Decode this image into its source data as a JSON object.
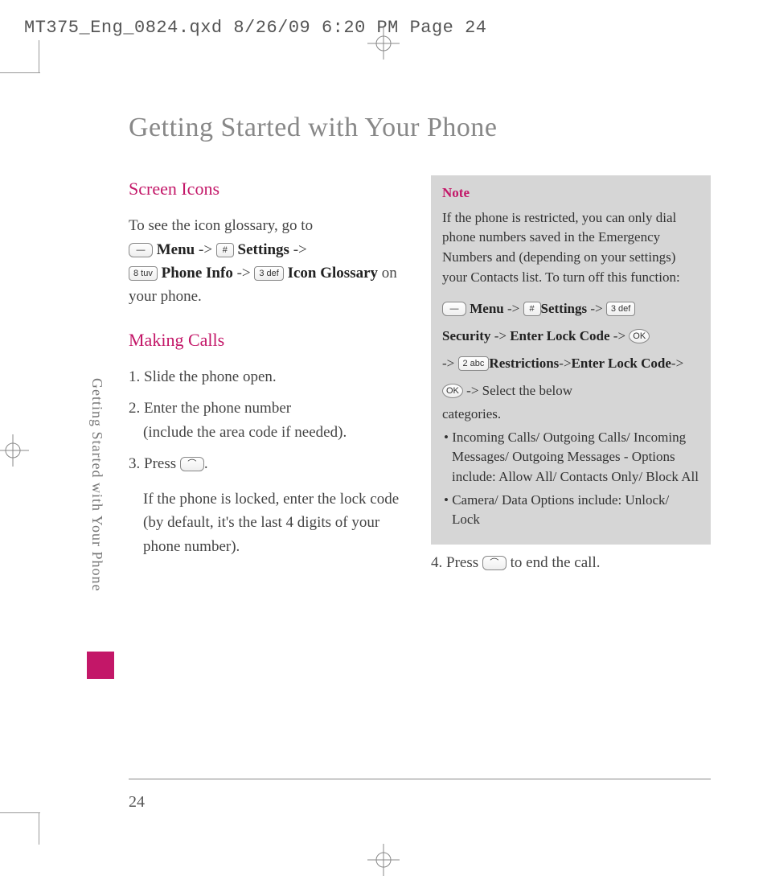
{
  "header_line": "MT375_Eng_0824.qxd  8/26/09  6:20 PM  Page 24",
  "side_tab": "Getting Started with Your Phone",
  "title": "Getting Started with Your Phone",
  "page_number": "24",
  "left": {
    "section1_title": "Screen Icons",
    "section1_intro": "To see the icon glossary, go to",
    "s1_menu": "Menu",
    "s1_settings": "Settings",
    "s1_phoneinfo": "Phone Info",
    "s1_iconglossary": "Icon Glossary",
    "s1_tail": " on your phone.",
    "section2_title": "Making Calls",
    "step1": "1. Slide the phone open.",
    "step2a": "2. Enter the phone number",
    "step2b": "(include the area code if needed).",
    "step3": "3. Press ",
    "step3_tail": ".",
    "locked": "If the phone is locked, enter the lock code (by default, it's the last 4 digits of your phone number)."
  },
  "right": {
    "note_title": "Note",
    "note_p1": "If the phone is restricted, you can only dial phone numbers saved in the Emergency Numbers and (depending on your settings) your Contacts list. To turn off this function:",
    "nav_menu": "Menu",
    "nav_settings": "Settings",
    "nav_security": "Security",
    "nav_enterlock": "Enter Lock Code",
    "nav_restrictions": "Restrictions",
    "nav_enterlock2": "Enter Lock Code",
    "nav_select": "Select the below",
    "nav_categories": "categories.",
    "bullet1": "• Incoming Calls/ Outgoing Calls/ Incoming Messages/ Outgoing Messages - Options include: Allow All/ Contacts Only/ Block All",
    "bullet2": "• Camera/ Data Options include: Unlock/ Lock",
    "step4": "4. Press ",
    "step4_tail": " to end the call."
  },
  "keys": {
    "softkey": "—",
    "hash": "#",
    "k8": "8 tuv",
    "k3": "3 def",
    "k2": "2 abc",
    "send": "⌒",
    "end": "⌒",
    "ok": "OK"
  }
}
